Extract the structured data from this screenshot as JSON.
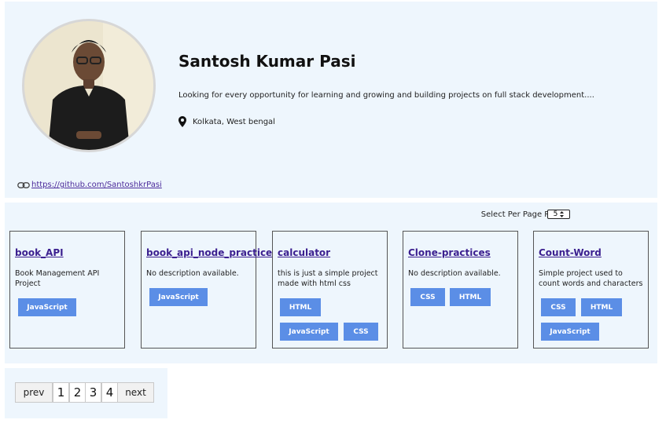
{
  "profile": {
    "name": "Santosh Kumar Pasi",
    "bio": "Looking for every opportunity for learning and growing and building projects on full stack development....",
    "location": "Kolkata, West bengal",
    "github_url": "https://github.com/SantoshkrPasi"
  },
  "repos_controls": {
    "per_page_label": "Select Per Page Repos:",
    "per_page_value": "5"
  },
  "repos": [
    {
      "title": "book_API",
      "description": "Book Management API Project",
      "tags": [
        "JavaScript"
      ]
    },
    {
      "title": "book_api_node_practice",
      "description": "No description available.",
      "tags": [
        "JavaScript"
      ]
    },
    {
      "title": "calculator",
      "description": "this is just a simple project made with html css",
      "tags": [
        "HTML",
        "JavaScript",
        "CSS"
      ]
    },
    {
      "title": "Clone-practices",
      "description": "No description available.",
      "tags": [
        "CSS",
        "HTML"
      ]
    },
    {
      "title": "Count-Word",
      "description": "Simple project used to count words and characters",
      "tags": [
        "CSS",
        "HTML",
        "JavaScript"
      ]
    }
  ],
  "pagination": {
    "prev_label": "prev",
    "pages": [
      "1",
      "2",
      "3",
      "4"
    ],
    "next_label": "next"
  },
  "colors": {
    "panel_bg": "#eef6fd",
    "tag_bg": "#5b8ee6",
    "link": "#3b1f8f"
  },
  "icons": {
    "location": "map-pin-icon",
    "link": "link-chain-icon",
    "select": "up-down-arrows-icon"
  }
}
